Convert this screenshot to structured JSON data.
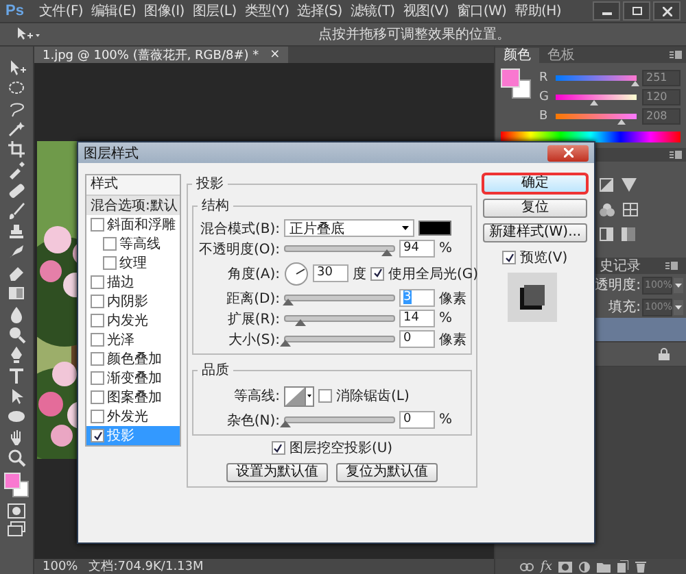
{
  "menu_bar": {
    "logo": "Ps",
    "items": [
      "文件(F)",
      "编辑(E)",
      "图像(I)",
      "图层(L)",
      "类型(Y)",
      "选择(S)",
      "滤镜(T)",
      "视图(V)",
      "窗口(W)",
      "帮助(H)"
    ]
  },
  "options_bar": {
    "hint": "点按并拖移可调整效果的位置。"
  },
  "document_tab": {
    "title": "1.jpg @ 100% (蔷薇花开, RGB/8#) *",
    "close": "×"
  },
  "color_panel": {
    "tabs": [
      {
        "label": "颜色",
        "selected": true
      },
      {
        "label": "色板",
        "selected": false
      }
    ],
    "channels": [
      {
        "name": "R",
        "value": "251",
        "level": 0.98
      },
      {
        "name": "G",
        "value": "120",
        "level": 0.47
      },
      {
        "name": "B",
        "value": "208",
        "level": 0.82
      }
    ]
  },
  "history_panel": {
    "tab": "史记录"
  },
  "layers_panel": {
    "opacity_label": "透明度:",
    "opacity": "100%",
    "fill_label": "填充:",
    "fill": "100%",
    "layers": [
      {
        "selected": true,
        "locked": false
      },
      {
        "selected": false,
        "locked": true
      }
    ],
    "footer_fx": "fx"
  },
  "status_bar": {
    "zoom": "100%",
    "document": "文档:704.9K/1.13M"
  },
  "dialog": {
    "title": "图层样式",
    "styles_header": "样式",
    "styles": [
      {
        "kind": "plain",
        "label": "混合选项:默认",
        "selected": false
      },
      {
        "kind": "check",
        "label": "斜面和浮雕",
        "checked": false,
        "selected": false,
        "children": [
          {
            "kind": "check",
            "label": "等高线",
            "checked": false,
            "selected": false
          },
          {
            "kind": "check",
            "label": "纹理",
            "checked": false,
            "selected": false
          }
        ]
      },
      {
        "kind": "check",
        "label": "描边",
        "checked": false,
        "selected": false
      },
      {
        "kind": "check",
        "label": "内阴影",
        "checked": false,
        "selected": false
      },
      {
        "kind": "check",
        "label": "内发光",
        "checked": false,
        "selected": false
      },
      {
        "kind": "check",
        "label": "光泽",
        "checked": false,
        "selected": false
      },
      {
        "kind": "check",
        "label": "颜色叠加",
        "checked": false,
        "selected": false
      },
      {
        "kind": "check",
        "label": "渐变叠加",
        "checked": false,
        "selected": false
      },
      {
        "kind": "check",
        "label": "图案叠加",
        "checked": false,
        "selected": false
      },
      {
        "kind": "check",
        "label": "外发光",
        "checked": false,
        "selected": false
      },
      {
        "kind": "check",
        "label": "投影",
        "checked": true,
        "selected": true
      }
    ],
    "section_title": "投影",
    "structure": {
      "title": "结构",
      "rows": [
        {
          "kind": "select",
          "label": "混合模式(B):",
          "value": "正片叠底"
        },
        {
          "kind": "slider",
          "label": "不透明度(O):",
          "level": 0.94,
          "value": "94",
          "unit": "%",
          "value_selected": false
        },
        {
          "kind": "angle",
          "label": "角度(A):",
          "value": "30",
          "unit": "度",
          "check_label": "使用全局光(G)",
          "checked": true
        },
        {
          "kind": "slider",
          "label": "距离(D):",
          "level": 0.03,
          "value": "3",
          "unit": "像素",
          "value_selected": true
        },
        {
          "kind": "slider",
          "label": "扩展(R):",
          "level": 0.14,
          "value": "14",
          "unit": "%",
          "value_selected": false
        },
        {
          "kind": "slider",
          "label": "大小(S):",
          "level": 0,
          "value": "0",
          "unit": "像素",
          "value_selected": false
        }
      ]
    },
    "quality": {
      "title": "品质",
      "contour_label": "等高线:",
      "anti_alias": {
        "label": "消除锯齿(L)",
        "checked": false
      },
      "noise": {
        "label": "杂色(N):",
        "level": 0,
        "value": "0",
        "unit": "%"
      }
    },
    "knockout": {
      "label": "图层挖空投影(U)",
      "checked": true
    },
    "default_buttons": [
      "设置为默认值",
      "复位为默认值"
    ],
    "buttons": [
      {
        "label": "确定",
        "primary": true,
        "highlighted": true
      },
      {
        "label": "复位",
        "primary": false,
        "highlighted": false
      },
      {
        "label": "新建样式(W)...",
        "primary": false,
        "highlighted": false
      }
    ],
    "preview": {
      "label": "预览(V)",
      "checked": true
    }
  }
}
